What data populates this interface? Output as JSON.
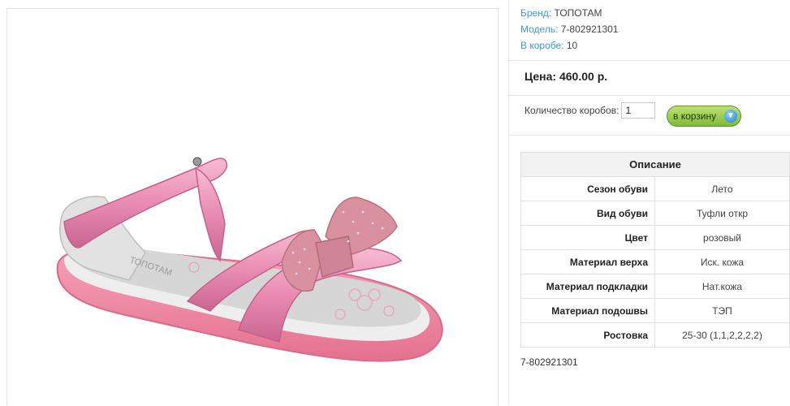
{
  "product": {
    "brand_label": "Бренд:",
    "brand_value": "ТОПОТАМ",
    "model_label": "Модель:",
    "model_value": "7-802921301",
    "box_label": "В коробе:",
    "box_value": "10",
    "price": "Цена: 460.00 р.",
    "qty_label": "Количество коробов:",
    "qty_value": "1",
    "cart_label": "в корзину",
    "bottom_code": "7-802921301"
  },
  "specs": {
    "title": "Описание",
    "rows": [
      {
        "k": "Сезон обуви",
        "v": "Лето"
      },
      {
        "k": "Вид обуви",
        "v": "Туфли откр"
      },
      {
        "k": "Цвет",
        "v": "розовый"
      },
      {
        "k": "Материал верха",
        "v": "Иск. кожа"
      },
      {
        "k": "Материал подкладки",
        "v": "Нат.кожа"
      },
      {
        "k": "Материал подошвы",
        "v": "ТЭП"
      },
      {
        "k": "Ростовка",
        "v": "25-30 (1,1,2,2,2,2)"
      }
    ]
  },
  "image": {
    "insole_print": "ТОПОТАМ",
    "colors": {
      "pink": "#e98bb2",
      "sole": "#f08aa4",
      "insole": "#d6d6d6"
    }
  },
  "icons": {
    "cart": "cart-icon"
  }
}
